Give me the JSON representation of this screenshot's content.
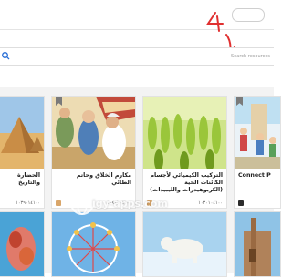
{
  "search": {
    "placeholder": "Search resources"
  },
  "annotation": {
    "text": "4"
  },
  "cards": [
    {
      "title": "الحضارة والتاريخ",
      "views": "",
      "docs": "",
      "code": "١٠٣٩٠١٤١٠٠"
    },
    {
      "title": "مكارم الخلاق وحاتم الطائي",
      "views": "",
      "docs": "",
      "code": "١٠٤٠١٠٤١٠٠"
    },
    {
      "title": "التركيب الكيميائي لأجسام الكائنات الحية (الكربوهيدرات والليبيدات)",
      "views": "",
      "docs": "",
      "code": "١٠٣٠١٠٤١٠٠"
    },
    {
      "title": "Connect P"
    }
  ],
  "watermark": {
    "text": "igy-apps.com"
  },
  "colors": {
    "annotation": "#e03030",
    "badge": "#d9a66a",
    "bookmark": "#7a7a7a"
  }
}
